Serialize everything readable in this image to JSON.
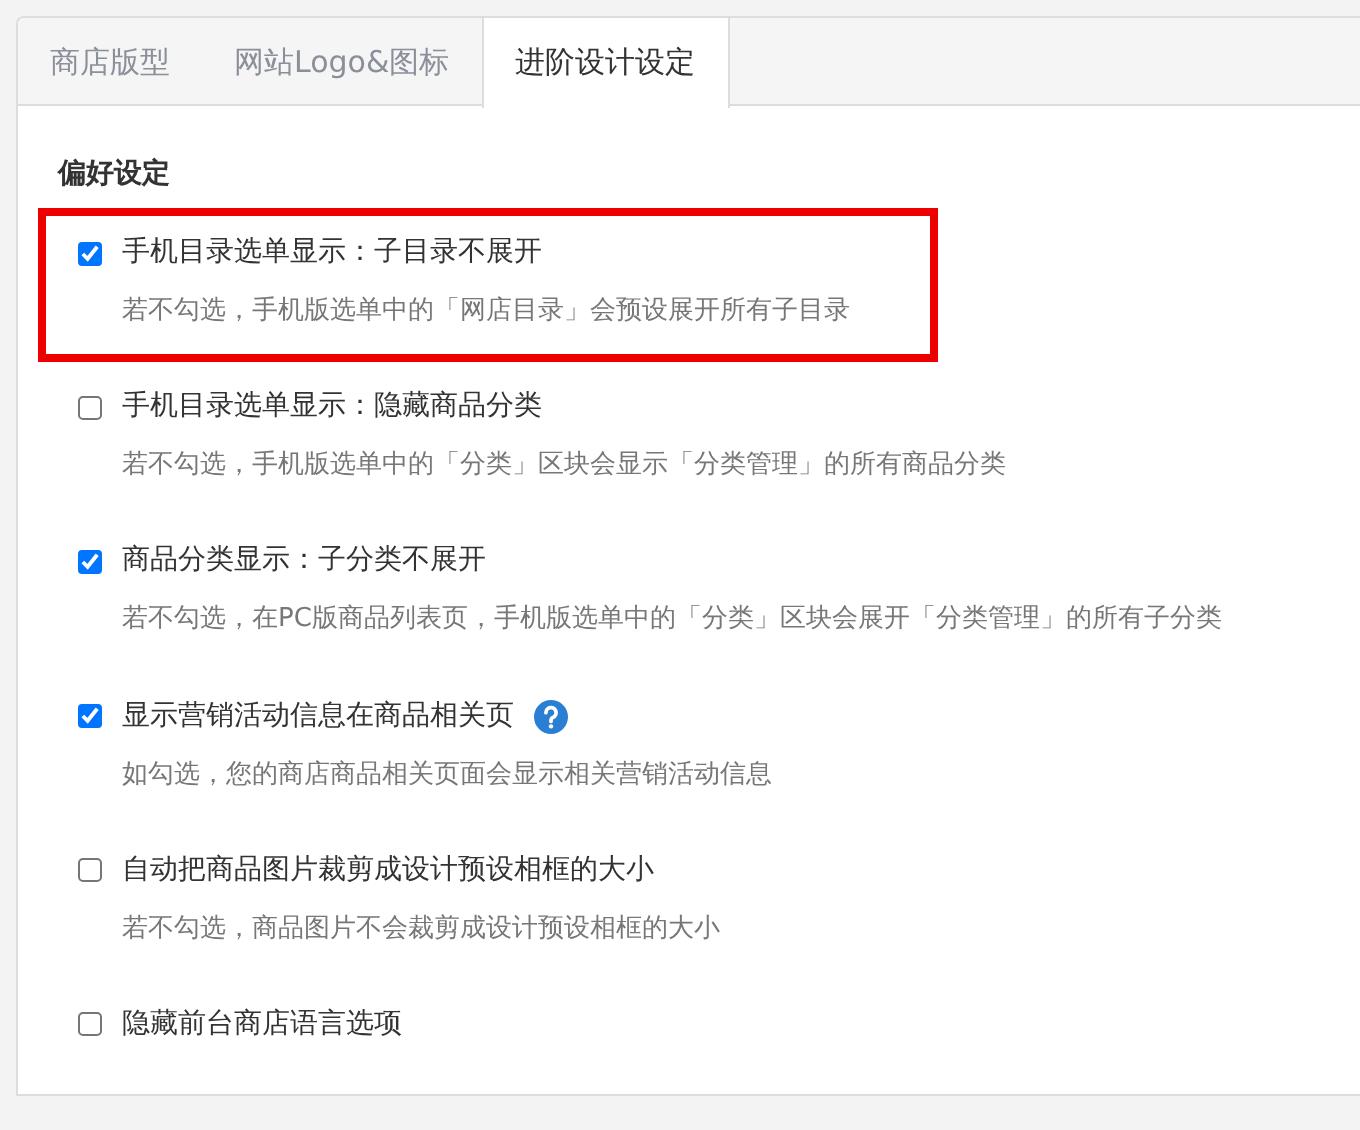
{
  "tabs": [
    {
      "label": "商店版型",
      "selected": false
    },
    {
      "label": "网站Logo&图标",
      "selected": false
    },
    {
      "label": "进阶设计设定",
      "selected": true
    }
  ],
  "section_title": "偏好设定",
  "options": [
    {
      "label": "手机目录选单显示：子目录不展开",
      "checked": true,
      "highlighted": true,
      "help": false,
      "description": "若不勾选，手机版选单中的「网店目录」会预设展开所有子目录"
    },
    {
      "label": "手机目录选单显示：隐藏商品分类",
      "checked": false,
      "highlighted": false,
      "help": false,
      "description": "若不勾选，手机版选单中的「分类」区块会显示「分类管理」的所有商品分类"
    },
    {
      "label": "商品分类显示：子分类不展开",
      "checked": true,
      "highlighted": false,
      "help": false,
      "description": "若不勾选，在PC版商品列表页，手机版选单中的「分类」区块会展开「分类管理」的所有子分类"
    },
    {
      "label": "显示营销活动信息在商品相关页",
      "checked": true,
      "highlighted": false,
      "help": true,
      "description": "如勾选，您的商店商品相关页面会显示相关营销活动信息"
    },
    {
      "label": "自动把商品图片裁剪成设计预设相框的大小",
      "checked": false,
      "highlighted": false,
      "help": false,
      "description": "若不勾选，商品图片不会裁剪成设计预设相框的大小"
    },
    {
      "label": "隐藏前台商店语言选项",
      "checked": false,
      "highlighted": false,
      "help": false
    }
  ]
}
